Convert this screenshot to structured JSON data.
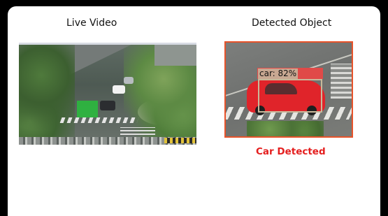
{
  "panels": {
    "live_title": "Live Video",
    "detected_title": "Detected Object"
  },
  "detection": {
    "label": "car: 82%",
    "status": "Car Detected",
    "status_color": "#e41e1e",
    "frame_color": "#e8532a"
  }
}
